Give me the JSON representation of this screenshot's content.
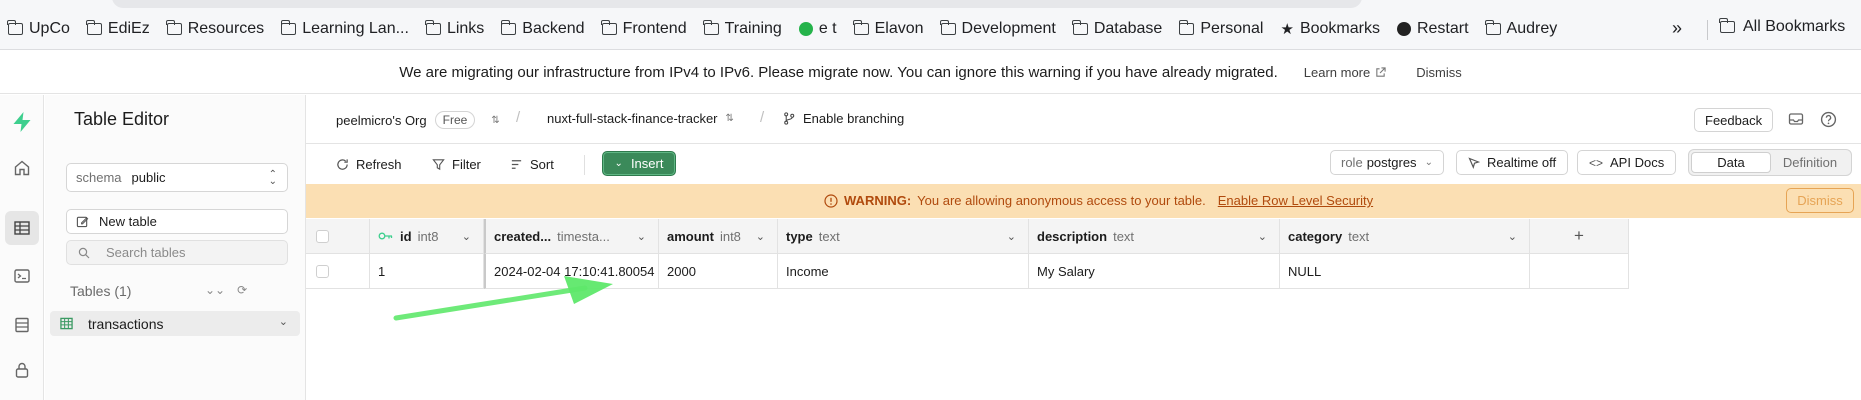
{
  "bookmarks": {
    "items": [
      {
        "label": "UpCo",
        "icon": "folder"
      },
      {
        "label": "EdiEz",
        "icon": "folder"
      },
      {
        "label": "Resources",
        "icon": "folder"
      },
      {
        "label": "Learning Lan...",
        "icon": "folder"
      },
      {
        "label": "Links",
        "icon": "folder"
      },
      {
        "label": "Backend",
        "icon": "folder"
      },
      {
        "label": "Frontend",
        "icon": "folder"
      },
      {
        "label": "Training",
        "icon": "folder"
      },
      {
        "label": "e t",
        "icon": "whatsapp"
      },
      {
        "label": "Elavon",
        "icon": "folder"
      },
      {
        "label": "Development",
        "icon": "folder"
      },
      {
        "label": "Database",
        "icon": "folder"
      },
      {
        "label": "Personal",
        "icon": "folder"
      },
      {
        "label": "Bookmarks",
        "icon": "star"
      },
      {
        "label": "Restart",
        "icon": "globe"
      },
      {
        "label": "Audrey",
        "icon": "folder"
      }
    ],
    "more": "»",
    "all_bookmarks": "All Bookmarks"
  },
  "notice": {
    "text": "We are migrating our infrastructure from IPv4 to IPv6. Please migrate now. You can ignore this warning if you have already migrated.",
    "learn_more": "Learn more",
    "dismiss": "Dismiss"
  },
  "sidebar": {
    "title": "Table Editor",
    "schema_label": "schema",
    "schema_value": "public",
    "new_table": "New table",
    "search_placeholder": "Search tables",
    "tables_heading": "Tables (1)",
    "tables": [
      {
        "name": "transactions"
      }
    ]
  },
  "header": {
    "org": "peelmicro's Org",
    "plan": "Free",
    "project": "nuxt-full-stack-finance-tracker",
    "branching": "Enable branching",
    "feedback": "Feedback"
  },
  "toolbar": {
    "refresh": "Refresh",
    "filter": "Filter",
    "sort": "Sort",
    "insert": "Insert",
    "role_label": "role",
    "role_value": "postgres",
    "realtime": "Realtime off",
    "api_docs": "API Docs",
    "view_data": "Data",
    "view_definition": "Definition"
  },
  "warning": {
    "strong": "WARNING:",
    "text": "You are allowing anonymous access to your table.",
    "link": "Enable Row Level Security",
    "dismiss": "Dismiss",
    "color": "#fbdfb3"
  },
  "grid": {
    "columns": [
      {
        "name": "id",
        "type": "int8",
        "primary_key": true
      },
      {
        "name": "created...",
        "type": "timesta..."
      },
      {
        "name": "amount",
        "type": "int8"
      },
      {
        "name": "type",
        "type": "text"
      },
      {
        "name": "description",
        "type": "text"
      },
      {
        "name": "category",
        "type": "text"
      }
    ],
    "add_column": "+",
    "rows": [
      {
        "id": "1",
        "created_at": "2024-02-04 17:10:41.80054",
        "amount": "2000",
        "type": "Income",
        "description": "My Salary",
        "category": "NULL"
      }
    ]
  },
  "colors": {
    "brand": "#3ecf8e",
    "insert_button": "#3b8a5a",
    "warning_text": "#b04a0d",
    "annotation_arrow": "#5ee86a"
  }
}
